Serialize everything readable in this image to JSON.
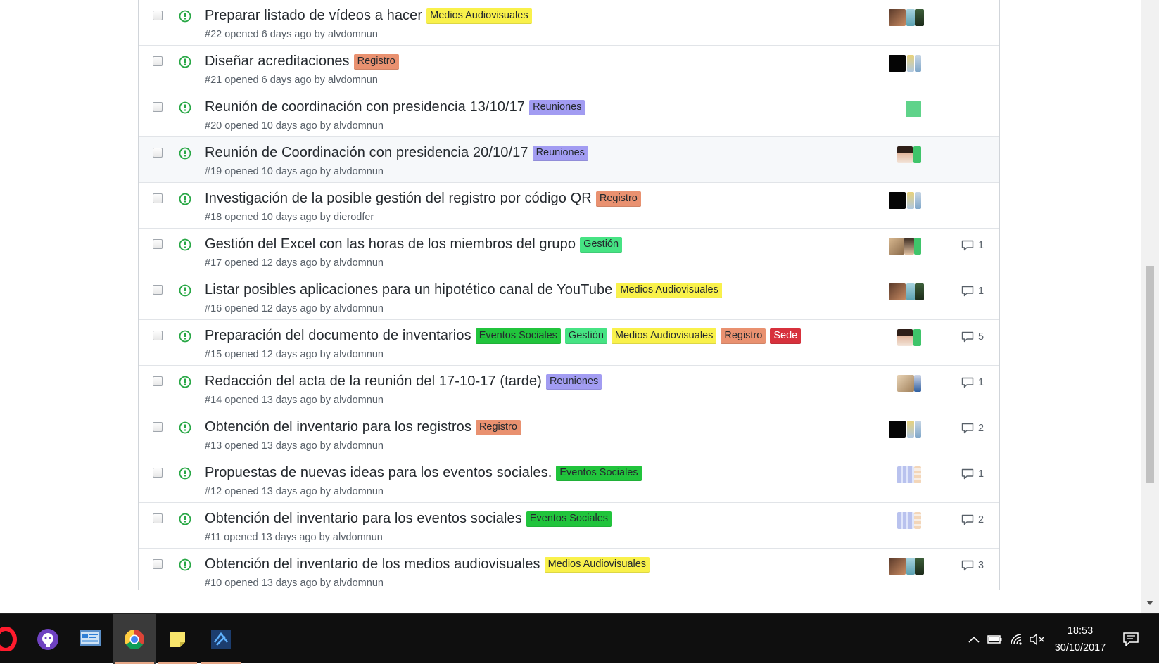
{
  "issues": [
    {
      "title": "Preparar listado de vídeos a hacer",
      "number": "#22",
      "meta": "#22 opened 6 days ago by alvdomnun",
      "labels": [
        {
          "text": "Medios Audiovisuales",
          "bg": "#f9f14b",
          "fg": "#24292e"
        }
      ],
      "avatars": "portrait-a",
      "comments": ""
    },
    {
      "title": "Diseñar acreditaciones",
      "number": "#21",
      "meta": "#21 opened 6 days ago by alvdomnun",
      "labels": [
        {
          "text": "Registro",
          "bg": "#e99170",
          "fg": "#24292e"
        }
      ],
      "avatars": "dark-b",
      "comments": ""
    },
    {
      "title": "Reunión de coordinación con presidencia 13/10/17",
      "number": "#20",
      "meta": "#20 opened 10 days ago by alvdomnun",
      "labels": [
        {
          "text": "Reuniones",
          "bg": "#a29cf2",
          "fg": "#24292e"
        }
      ],
      "avatars": "green-only",
      "comments": ""
    },
    {
      "title": "Reunión de Coordinación con presidencia 20/10/17",
      "number": "#19",
      "meta": "#19 opened 10 days ago by alvdomnun",
      "labels": [
        {
          "text": "Reuniones",
          "bg": "#a29cf2",
          "fg": "#24292e"
        }
      ],
      "avatars": "woman-c",
      "comments": ""
    },
    {
      "title": "Investigación de la posible gestión del registro por código QR",
      "number": "#18",
      "meta": "#18 opened 10 days ago by dierodfer",
      "labels": [
        {
          "text": "Registro",
          "bg": "#e99170",
          "fg": "#24292e"
        }
      ],
      "avatars": "dark-b",
      "comments": ""
    },
    {
      "title": "Gestión del Excel con las horas de los miembros del grupo",
      "number": "#17",
      "meta": "#17 opened 12 days ago by alvdomnun",
      "labels": [
        {
          "text": "Gestión",
          "bg": "#46e383",
          "fg": "#24292e"
        }
      ],
      "avatars": "trio-d",
      "comments": "1"
    },
    {
      "title": "Listar posibles aplicaciones para un hipotético canal de YouTube",
      "number": "#16",
      "meta": "#16 opened 12 days ago by alvdomnun",
      "labels": [
        {
          "text": "Medios Audiovisuales",
          "bg": "#f9f14b",
          "fg": "#24292e"
        }
      ],
      "avatars": "portrait-a",
      "comments": "1"
    },
    {
      "title": "Preparación del documento de inventarios",
      "number": "#15",
      "meta": "#15 opened 12 days ago by alvdomnun",
      "labels": [
        {
          "text": "Eventos Sociales",
          "bg": "#21c43c",
          "fg": "#24292e"
        },
        {
          "text": "Gestión",
          "bg": "#46e383",
          "fg": "#24292e"
        },
        {
          "text": "Medios Audiovisuales",
          "bg": "#f9f14b",
          "fg": "#24292e"
        },
        {
          "text": "Registro",
          "bg": "#e99170",
          "fg": "#24292e"
        },
        {
          "text": "Sede",
          "bg": "#d7313c",
          "fg": "#ffffff"
        }
      ],
      "avatars": "woman-c",
      "comments": "5"
    },
    {
      "title": "Redacción del acta de la reunión del 17-10-17 (tarde)",
      "number": "#14",
      "meta": "#14 opened 13 days ago by alvdomnun",
      "labels": [
        {
          "text": "Reuniones",
          "bg": "#a29cf2",
          "fg": "#24292e"
        }
      ],
      "avatars": "duo-e",
      "comments": "1"
    },
    {
      "title": "Obtención del inventario para los registros",
      "number": "#13",
      "meta": "#13 opened 13 days ago by alvdomnun",
      "labels": [
        {
          "text": "Registro",
          "bg": "#e99170",
          "fg": "#24292e"
        }
      ],
      "avatars": "dark-b",
      "comments": "2"
    },
    {
      "title": "Propuestas de nuevas ideas para los eventos sociales.",
      "number": "#12",
      "meta": "#12 opened 13 days ago by alvdomnun",
      "labels": [
        {
          "text": "Eventos Sociales",
          "bg": "#21c43c",
          "fg": "#24292e"
        }
      ],
      "avatars": "pattern-f",
      "comments": "1"
    },
    {
      "title": "Obtención del inventario para los eventos sociales",
      "number": "#11",
      "meta": "#11 opened 13 days ago by alvdomnun",
      "labels": [
        {
          "text": "Eventos Sociales",
          "bg": "#21c43c",
          "fg": "#24292e"
        }
      ],
      "avatars": "pattern-f",
      "comments": "2"
    },
    {
      "title": "Obtención del inventario de los medios audiovisuales",
      "number": "#10",
      "meta": "#10 opened 13 days ago by alvdomnun",
      "labels": [
        {
          "text": "Medios Audiovisuales",
          "bg": "#f9f14b",
          "fg": "#24292e"
        }
      ],
      "avatars": "portrait-a",
      "comments": "3"
    }
  ],
  "hover_row_index": 3,
  "colors": {
    "open_icon": "#28a745",
    "comment_icon": "#586069"
  },
  "taskbar": {
    "apps": [
      "opera-icon",
      "github-desktop-icon",
      "control-panel-icon",
      "chrome-icon",
      "sticky-notes-icon",
      "visual-studio-icon"
    ],
    "active_app": "chrome-icon",
    "clock_time": "18:53",
    "clock_date": "30/10/2017"
  }
}
